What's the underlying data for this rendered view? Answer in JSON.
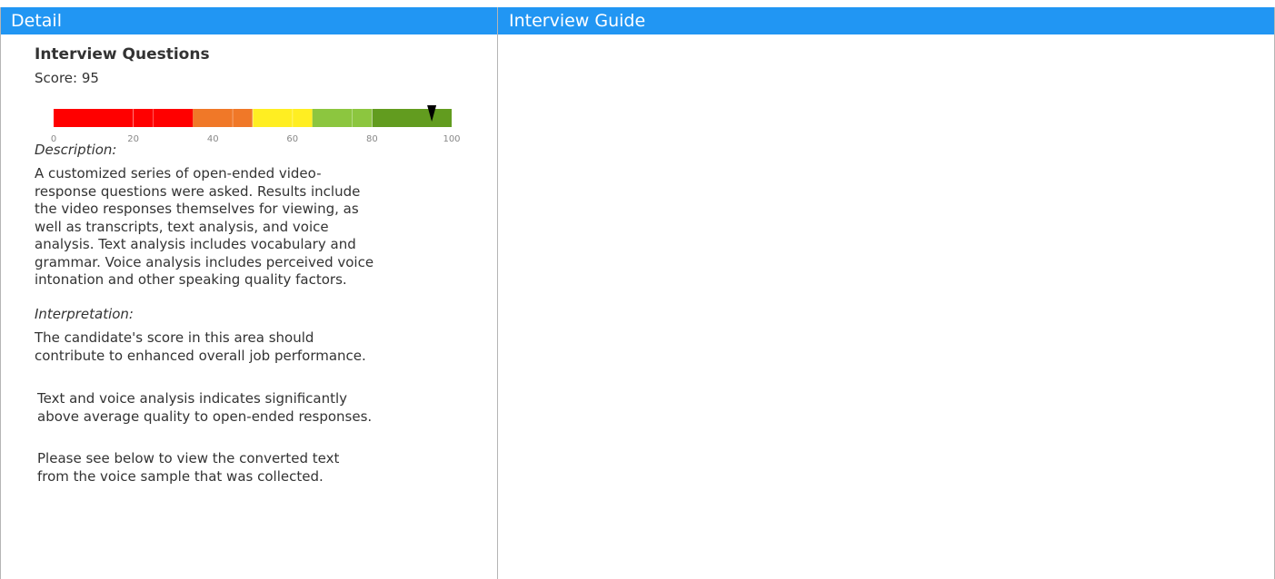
{
  "left_panel": {
    "header": "Detail",
    "section_title": "Interview Questions",
    "score_text": "Score: 95",
    "gauge": {
      "score": 95,
      "min": 0,
      "max": 100,
      "ticks": [
        "0",
        "20",
        "40",
        "60",
        "80",
        "100"
      ],
      "bands": [
        {
          "from": 0,
          "to": 35,
          "color": "#ff0000"
        },
        {
          "from": 35,
          "to": 50,
          "color": "#f07828"
        },
        {
          "from": 50,
          "to": 65,
          "color": "#ffee22"
        },
        {
          "from": 65,
          "to": 80,
          "color": "#8cc63f"
        },
        {
          "from": 80,
          "to": 100,
          "color": "#629c1f"
        }
      ]
    },
    "description_label": "Description:",
    "description_text": "A customized series of open-ended video-\nresponse questions were asked. Results include\nthe video responses themselves for viewing, as\nwell as  transcripts, text analysis, and voice\nanalysis. Text analysis includes vocabulary and\ngrammar. Voice analysis includes perceived voice\nintonation and other speaking quality factors.",
    "interpretation_label": "Interpretation:",
    "interpretation_text": "The candidate's score in this area should\ncontribute to enhanced overall job performance.",
    "analysis_text": "Text and voice analysis indicates significantly\nabove average quality to open-ended responses.",
    "note_text": "Please see below to view the converted text\nfrom the voice sample that was collected."
  },
  "right_panel": {
    "header": "Interview Guide"
  },
  "colors": {
    "header_bg": "#2196f3",
    "border": "#b5b5b5"
  }
}
